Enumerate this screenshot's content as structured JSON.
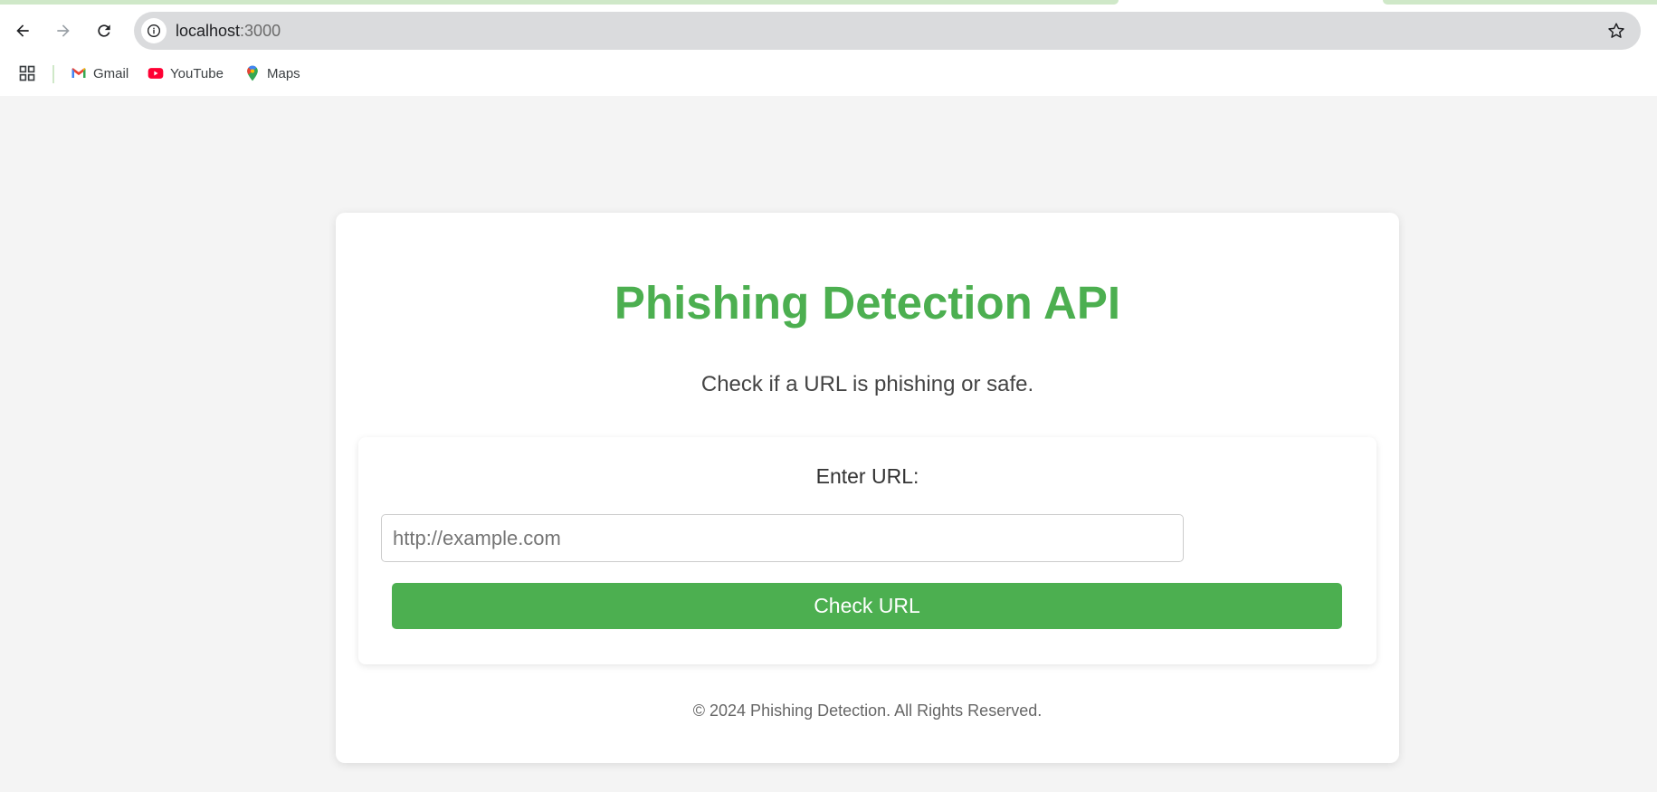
{
  "browser": {
    "url_host": "localhost",
    "url_port": ":3000",
    "bookmarks": [
      {
        "label": "Gmail",
        "icon": "gmail-icon"
      },
      {
        "label": "YouTube",
        "icon": "youtube-icon"
      },
      {
        "label": "Maps",
        "icon": "maps-icon"
      }
    ]
  },
  "page": {
    "title": "Phishing Detection API",
    "subtitle": "Check if a URL is phishing or safe.",
    "form": {
      "label": "Enter URL:",
      "input_value": "",
      "input_placeholder": "http://example.com",
      "submit_label": "Check URL"
    },
    "footer": "© 2024 Phishing Detection. All Rights Reserved."
  },
  "colors": {
    "accent": "#4caf50",
    "background": "#f4f4f4"
  }
}
